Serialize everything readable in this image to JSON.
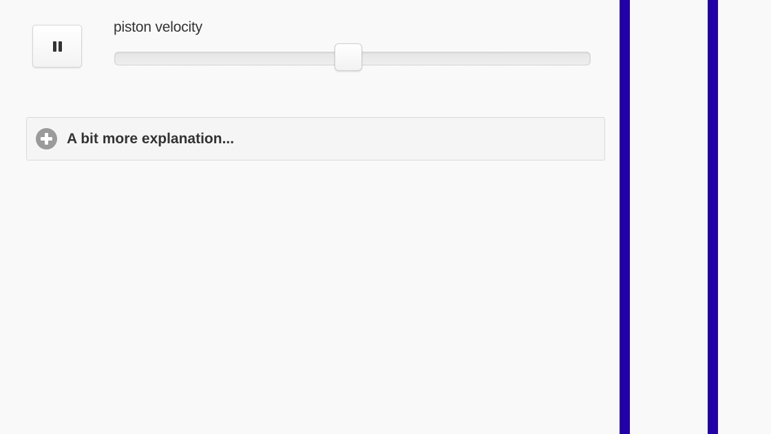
{
  "controls": {
    "pause_button": {
      "icon": "pause-icon"
    },
    "velocity_slider": {
      "label": "piston velocity",
      "value_fraction": 0.5
    }
  },
  "explanation_panel": {
    "label": "A bit more explanation...",
    "icon": "plus-circle-icon",
    "expanded": false
  },
  "simulation": {
    "wall_color": "#2300a8"
  }
}
